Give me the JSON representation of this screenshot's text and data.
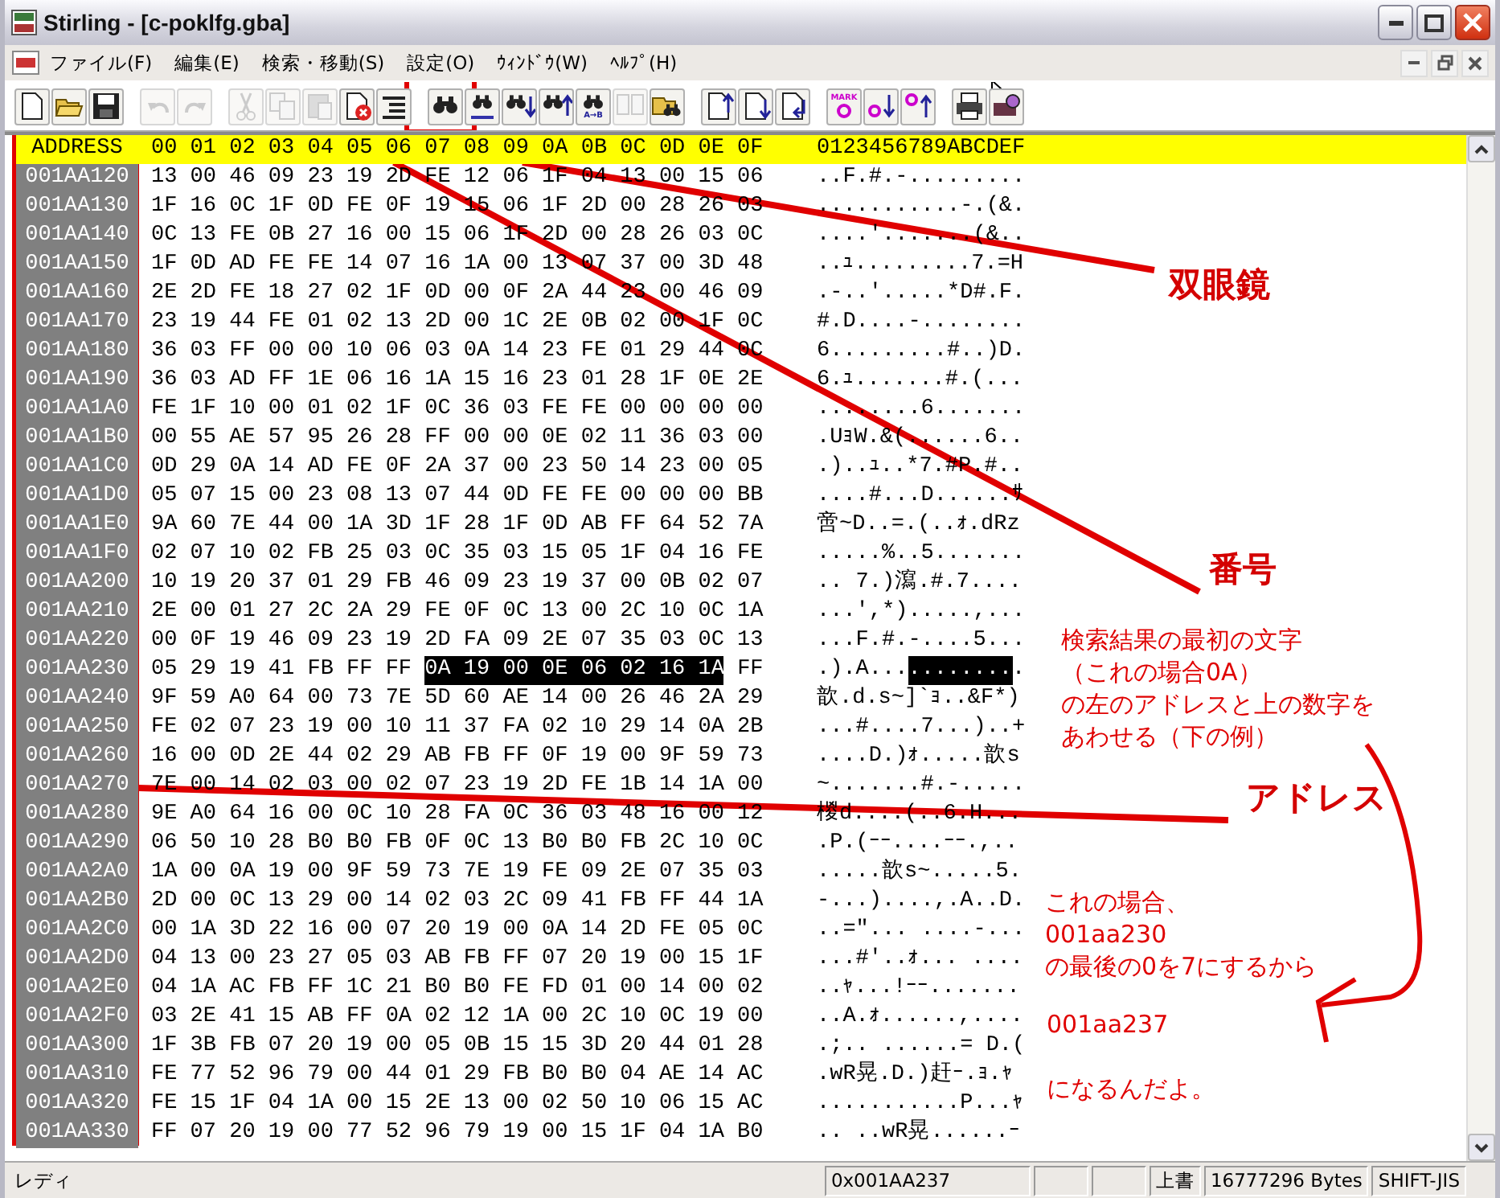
{
  "window": {
    "title": "Stirling - [c-poklfg.gba]"
  },
  "menu": [
    {
      "label": "ファイル(F)"
    },
    {
      "label": "編集(E)"
    },
    {
      "label": "検索・移動(S)"
    },
    {
      "label": "設定(O)"
    },
    {
      "label": "ｳｨﾝﾄﾞｳ(W)"
    },
    {
      "label": "ﾍﾙﾌﾟ(H)"
    }
  ],
  "toolbar": [
    {
      "kind": "new",
      "disabled": false
    },
    {
      "kind": "open",
      "disabled": false
    },
    {
      "kind": "save",
      "disabled": false
    },
    {
      "kind": "undo",
      "disabled": true
    },
    {
      "kind": "redo",
      "disabled": true
    },
    {
      "kind": "cut",
      "disabled": true
    },
    {
      "kind": "copy",
      "disabled": true
    },
    {
      "kind": "paste",
      "disabled": true
    },
    {
      "kind": "delete",
      "disabled": false
    },
    {
      "kind": "list",
      "disabled": false
    },
    {
      "kind": "find",
      "disabled": false
    },
    {
      "kind": "replace",
      "disabled": false
    },
    {
      "kind": "find-next",
      "disabled": false
    },
    {
      "kind": "find-prev",
      "disabled": false
    },
    {
      "kind": "compare",
      "label": "A→B",
      "disabled": false
    },
    {
      "kind": "pages",
      "disabled": true
    },
    {
      "kind": "jump",
      "disabled": false
    },
    {
      "kind": "page-up",
      "disabled": false
    },
    {
      "kind": "page-down",
      "disabled": false
    },
    {
      "kind": "page-return",
      "disabled": false
    },
    {
      "kind": "mark",
      "label": "MARK",
      "disabled": false
    },
    {
      "kind": "mark-next",
      "disabled": false
    },
    {
      "kind": "mark-prev",
      "disabled": false
    },
    {
      "kind": "print",
      "disabled": false
    },
    {
      "kind": "print-setup",
      "disabled": false
    }
  ],
  "editor": {
    "header": {
      "address": "ADDRESS",
      "hex": "00 01 02 03 04 05 06 07 08 09 0A 0B 0C 0D 0E 0F",
      "ascii": "0123456789ABCDEF"
    },
    "rows": [
      {
        "address": "001AA120",
        "hex": [
          {
            "text": "13 00 46 09 23 19 2D FE 12 06 1F 04 13 00 15 06",
            "selected": false
          }
        ],
        "ascii": [
          {
            "text": "..F.#.-.........",
            "selected": false
          }
        ]
      },
      {
        "address": "001AA130",
        "hex": [
          {
            "text": "1F 16 0C 1F 0D FE 0F 19 15 06 1F 2D 00 28 26 03",
            "selected": false
          }
        ],
        "ascii": [
          {
            "text": "...........-.(&.",
            "selected": false
          }
        ]
      },
      {
        "address": "001AA140",
        "hex": [
          {
            "text": "0C 13 FE 0B 27 16 00 15 06 1F 2D 00 28 26 03 0C",
            "selected": false
          }
        ],
        "ascii": [
          {
            "text": "....'.......(&..",
            "selected": false
          }
        ]
      },
      {
        "address": "001AA150",
        "hex": [
          {
            "text": "1F 0D AD FE FE 14 07 16 1A 00 13 07 37 00 3D 48",
            "selected": false
          }
        ],
        "ascii": [
          {
            "text": "..ｭ.........7.=H",
            "selected": false
          }
        ]
      },
      {
        "address": "001AA160",
        "hex": [
          {
            "text": "2E 2D FE 18 27 02 1F 0D 00 0F 2A 44 23 00 46 09",
            "selected": false
          }
        ],
        "ascii": [
          {
            "text": ".-..'.....*D#.F.",
            "selected": false
          }
        ]
      },
      {
        "address": "001AA170",
        "hex": [
          {
            "text": "23 19 44 FE 01 02 13 2D 00 1C 2E 0B 02 00 1F 0C",
            "selected": false
          }
        ],
        "ascii": [
          {
            "text": "#.D....-........",
            "selected": false
          }
        ]
      },
      {
        "address": "001AA180",
        "hex": [
          {
            "text": "36 03 FF 00 00 10 06 03 0A 14 23 FE 01 29 44 0C",
            "selected": false
          }
        ],
        "ascii": [
          {
            "text": "6.........#..)D.",
            "selected": false
          }
        ]
      },
      {
        "address": "001AA190",
        "hex": [
          {
            "text": "36 03 AD FF 1E 06 16 1A 15 16 23 01 28 1F 0E 2E",
            "selected": false
          }
        ],
        "ascii": [
          {
            "text": "6.ｭ.......#.(...",
            "selected": false
          }
        ]
      },
      {
        "address": "001AA1A0",
        "hex": [
          {
            "text": "FE 1F 10 00 01 02 1F 0C 36 03 FE FE 00 00 00 00",
            "selected": false
          }
        ],
        "ascii": [
          {
            "text": "........6.......",
            "selected": false
          }
        ]
      },
      {
        "address": "001AA1B0",
        "hex": [
          {
            "text": "00 55 AE 57 95 26 28 FF 00 00 0E 02 11 36 03 00",
            "selected": false
          }
        ],
        "ascii": [
          {
            "text": ".UｮW.&(......6..",
            "selected": false
          }
        ]
      },
      {
        "address": "001AA1C0",
        "hex": [
          {
            "text": "0D 29 0A 14 AD FE 0F 2A 37 00 23 50 14 23 00 05",
            "selected": false
          }
        ],
        "ascii": [
          {
            "text": ".)..ｭ..*7.#P.#..",
            "selected": false
          }
        ]
      },
      {
        "address": "001AA1D0",
        "hex": [
          {
            "text": "05 07 15 00 23 08 13 07 44 0D FE FE 00 00 00 BB",
            "selected": false
          }
        ],
        "ascii": [
          {
            "text": "....#...D......ｻ",
            "selected": false
          }
        ]
      },
      {
        "address": "001AA1E0",
        "hex": [
          {
            "text": "9A 60 7E 44 00 1A 3D 1F 28 1F 0D AB FF 64 52 7A",
            "selected": false
          }
        ],
        "ascii": [
          {
            "text": "啻~D..=.(..ｫ.dRz",
            "selected": false
          }
        ]
      },
      {
        "address": "001AA1F0",
        "hex": [
          {
            "text": "02 07 10 02 FB 25 03 0C 35 03 15 05 1F 04 16 FE",
            "selected": false
          }
        ],
        "ascii": [
          {
            "text": ".....%..5.......",
            "selected": false
          }
        ]
      },
      {
        "address": "001AA200",
        "hex": [
          {
            "text": "10 19 20 37 01 29 FB 46 09 23 19 37 00 0B 02 07",
            "selected": false
          }
        ],
        "ascii": [
          {
            "text": ".. 7.)瀉.#.7....",
            "selected": false
          }
        ]
      },
      {
        "address": "001AA210",
        "hex": [
          {
            "text": "2E 00 01 27 2C 2A 29 FE 0F 0C 13 00 2C 10 0C 1A",
            "selected": false
          }
        ],
        "ascii": [
          {
            "text": "...',*).....,...",
            "selected": false
          }
        ]
      },
      {
        "address": "001AA220",
        "hex": [
          {
            "text": "00 0F 19 46 09 23 19 2D FA 09 2E 07 35 03 0C 13",
            "selected": false
          }
        ],
        "ascii": [
          {
            "text": "...F.#.-....5...",
            "selected": false
          }
        ]
      },
      {
        "address": "001AA230",
        "hex": [
          {
            "text": "05 29 19 41 FB FF FF",
            "selected": false
          },
          {
            "text": "0A 19 00 0E 06 02 16 1A",
            "selected": true
          },
          {
            "text": "FF",
            "selected": false
          }
        ],
        "ascii": [
          {
            "text": ".).A...",
            "selected": false
          },
          {
            "text": "........",
            "selected": true
          },
          {
            "text": ".",
            "selected": false
          }
        ]
      },
      {
        "address": "001AA240",
        "hex": [
          {
            "text": "9F 59 A0 64 00 73 7E 5D 60 AE 14 00 26 46 2A 29",
            "selected": false
          }
        ],
        "ascii": [
          {
            "text": "歆.d.s~]`ｮ..&F*)",
            "selected": false
          }
        ]
      },
      {
        "address": "001AA250",
        "hex": [
          {
            "text": "FE 02 07 23 19 00 10 11 37 FA 02 10 29 14 0A 2B",
            "selected": false
          }
        ],
        "ascii": [
          {
            "text": "...#....7...)..+",
            "selected": false
          }
        ]
      },
      {
        "address": "001AA260",
        "hex": [
          {
            "text": "16 00 0D 2E 44 02 29 AB FB FF 0F 19 00 9F 59 73",
            "selected": false
          }
        ],
        "ascii": [
          {
            "text": "....D.)ｫ.....歆s",
            "selected": false
          }
        ]
      },
      {
        "address": "001AA270",
        "hex": [
          {
            "text": "7E 00 14 02 03 00 02 07 23 19 2D FE 1B 14 1A 00",
            "selected": false
          }
        ],
        "ascii": [
          {
            "text": "~.......#.-.....",
            "selected": false
          }
        ]
      },
      {
        "address": "001AA280",
        "hex": [
          {
            "text": "9E A0 64 16 00 0C 10 28 FA 0C 36 03 48 16 00 12",
            "selected": false
          }
        ],
        "ascii": [
          {
            "text": "椶d....(..6.H...",
            "selected": false
          }
        ]
      },
      {
        "address": "001AA290",
        "hex": [
          {
            "text": "06 50 10 28 B0 B0 FB 0F 0C 13 B0 B0 FB 2C 10 0C",
            "selected": false
          }
        ],
        "ascii": [
          {
            "text": ".P.(ｰｰ....ｰｰ.,..",
            "selected": false
          }
        ]
      },
      {
        "address": "001AA2A0",
        "hex": [
          {
            "text": "1A 00 0A 19 00 9F 59 73 7E 19 FE 09 2E 07 35 03",
            "selected": false
          }
        ],
        "ascii": [
          {
            "text": ".....歆s~.....5.",
            "selected": false
          }
        ]
      },
      {
        "address": "001AA2B0",
        "hex": [
          {
            "text": "2D 00 0C 13 29 00 14 02 03 2C 09 41 FB FF 44 1A",
            "selected": false
          }
        ],
        "ascii": [
          {
            "text": "-...)....,.A..D.",
            "selected": false
          }
        ]
      },
      {
        "address": "001AA2C0",
        "hex": [
          {
            "text": "00 1A 3D 22 16 00 07 20 19 00 0A 14 2D FE 05 0C",
            "selected": false
          }
        ],
        "ascii": [
          {
            "text": "..=\"... ....-...",
            "selected": false
          }
        ]
      },
      {
        "address": "001AA2D0",
        "hex": [
          {
            "text": "04 13 00 23 27 05 03 AB FB FF 07 20 19 00 15 1F",
            "selected": false
          }
        ],
        "ascii": [
          {
            "text": "...#'..ｫ... ....",
            "selected": false
          }
        ]
      },
      {
        "address": "001AA2E0",
        "hex": [
          {
            "text": "04 1A AC FB FF 1C 21 B0 B0 FE FD 01 00 14 00 02",
            "selected": false
          }
        ],
        "ascii": [
          {
            "text": "..ｬ...!ｰｰ.......",
            "selected": false
          }
        ]
      },
      {
        "address": "001AA2F0",
        "hex": [
          {
            "text": "03 2E 41 15 AB FF 0A 02 12 1A 00 2C 10 0C 19 00",
            "selected": false
          }
        ],
        "ascii": [
          {
            "text": "..A.ｫ......,....",
            "selected": false
          }
        ]
      },
      {
        "address": "001AA300",
        "hex": [
          {
            "text": "1F 3B FB 07 20 19 00 05 0B 15 15 3D 20 44 01 28",
            "selected": false
          }
        ],
        "ascii": [
          {
            "text": ".;.. ......= D.(",
            "selected": false
          }
        ]
      },
      {
        "address": "001AA310",
        "hex": [
          {
            "text": "FE 77 52 96 79 00 44 01 29 FB B0 B0 04 AE 14 AC",
            "selected": false
          }
        ],
        "ascii": [
          {
            "text": ".wR晃.D.)赶ｰ.ｮ.ｬ",
            "selected": false
          }
        ]
      },
      {
        "address": "001AA320",
        "hex": [
          {
            "text": "FE 15 1F 04 1A 00 15 2E 13 00 02 50 10 06 15 AC",
            "selected": false
          }
        ],
        "ascii": [
          {
            "text": "...........P...ｬ",
            "selected": false
          }
        ]
      },
      {
        "address": "001AA330",
        "hex": [
          {
            "text": "FF 07 20 19 00 77 52 96 79 19 00 15 1F 04 1A B0",
            "selected": false
          }
        ],
        "ascii": [
          {
            "text": ".. ..wR晃......ｰ",
            "selected": false
          }
        ]
      }
    ]
  },
  "status_bar": {
    "message": "レディ",
    "position": "0x001AA237",
    "mode": "上書",
    "size": "16777296 Bytes",
    "encoding": "SHIFT-JIS"
  },
  "annotations": [
    {
      "kind": "label",
      "text": "双眼鏡"
    },
    {
      "kind": "label",
      "text": "番号"
    },
    {
      "kind": "note",
      "lines": [
        "検索結果の最初の文字",
        "（これの場合0A）",
        "の左のアドレスと上の数字を",
        "あわせる（下の例）"
      ]
    },
    {
      "kind": "label",
      "text": "アドレス"
    },
    {
      "kind": "note",
      "lines": [
        "これの場合、",
        "001aa230",
        "の最後の0を7にするから"
      ]
    },
    {
      "kind": "note",
      "lines": [
        "001aa237"
      ]
    },
    {
      "kind": "note",
      "lines": [
        "になるんだよ。"
      ]
    }
  ]
}
